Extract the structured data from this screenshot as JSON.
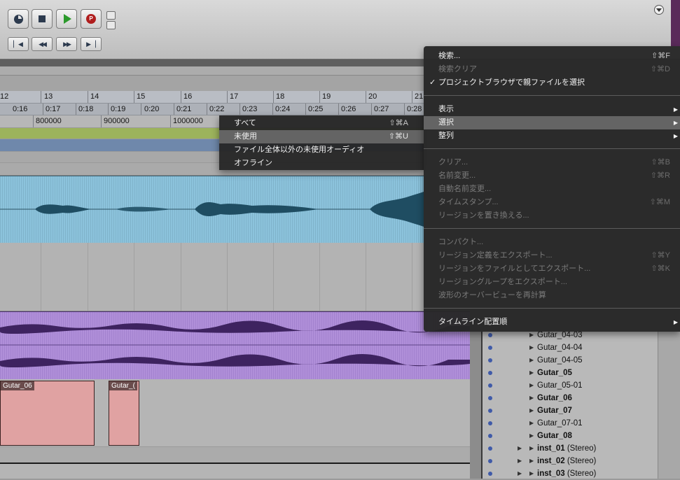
{
  "ruler": {
    "bars": [
      "12",
      "13",
      "14",
      "15",
      "16",
      "17",
      "18",
      "19",
      "20",
      "21"
    ],
    "times": [
      "0:16",
      "0:17",
      "0:18",
      "0:19",
      "0:20",
      "0:21",
      "0:22",
      "0:23",
      "0:24",
      "0:25",
      "0:26",
      "0:27",
      "0:28"
    ],
    "samples": [
      "800000",
      "900000",
      "1000000"
    ]
  },
  "clips": {
    "clip1": "Gutar_06",
    "clip2": "Gutar_("
  },
  "submenu": {
    "items": [
      {
        "label": "すべて",
        "shortcut": "⇧⌘A"
      },
      {
        "label": "未使用",
        "shortcut": "⇧⌘U"
      },
      {
        "label": "ファイル全体以外の未使用オーディオ",
        "shortcut": ""
      },
      {
        "label": "オフライン",
        "shortcut": ""
      }
    ]
  },
  "menu": {
    "items": [
      {
        "label": "検索...",
        "shortcut": "⇧⌘F"
      },
      {
        "label": "検索クリア",
        "shortcut": "⇧⌘D"
      },
      {
        "label": "プロジェクトブラウザで親ファイルを選択",
        "shortcut": "",
        "check": "✓"
      },
      {
        "label": "表示",
        "shortcut": ""
      },
      {
        "label": "選択",
        "shortcut": ""
      },
      {
        "label": "整列",
        "shortcut": ""
      },
      {
        "label": "クリア...",
        "shortcut": "⇧⌘B"
      },
      {
        "label": "名前変更...",
        "shortcut": "⇧⌘R"
      },
      {
        "label": "自動名前変更...",
        "shortcut": ""
      },
      {
        "label": "タイムスタンプ...",
        "shortcut": "⇧⌘M"
      },
      {
        "label": "リージョンを置き換える...",
        "shortcut": ""
      },
      {
        "label": "コンパクト...",
        "shortcut": ""
      },
      {
        "label": "リージョン定義をエクスポート...",
        "shortcut": "⇧⌘Y"
      },
      {
        "label": "リージョンをファイルとしてエクスポート...",
        "shortcut": "⇧⌘K"
      },
      {
        "label": "リージョングループをエクスポート...",
        "shortcut": ""
      },
      {
        "label": "波形のオーバービューを再計算",
        "shortcut": ""
      },
      {
        "label": "タイムライン配置順",
        "shortcut": ""
      }
    ]
  },
  "region_list": {
    "items": [
      {
        "name": "Gutar_04-03",
        "bold": false
      },
      {
        "name": "Gutar_04-04",
        "bold": false
      },
      {
        "name": "Gutar_04-05",
        "bold": false
      },
      {
        "name": "Gutar_05",
        "bold": true
      },
      {
        "name": "Gutar_05-01",
        "bold": false
      },
      {
        "name": "Gutar_06",
        "bold": true
      },
      {
        "name": "Gutar_07",
        "bold": true
      },
      {
        "name": "Gutar_07-01",
        "bold": false
      },
      {
        "name": "Gutar_08",
        "bold": true
      },
      {
        "name": "inst_01",
        "suffix": "(Stereo)",
        "bold": true
      },
      {
        "name": "inst_02",
        "suffix": "(Stereo)",
        "bold": true
      },
      {
        "name": "inst_03",
        "suffix": "(Stereo)",
        "bold": true
      }
    ]
  },
  "colors": {
    "audio_blue": "#8cc3dc",
    "audio_purple": "#b08fd9",
    "clip_pink": "#e0a2a2",
    "clip_green": "#9cb35c"
  }
}
